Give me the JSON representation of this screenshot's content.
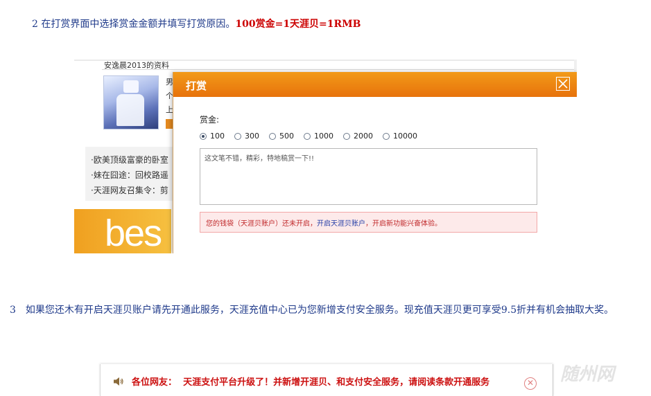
{
  "step2": {
    "text": "2 在打赏界面中选择赏金金额并填写打赏原因。",
    "highlight": "100赏金=1天涯贝=1RMB"
  },
  "screenshot": {
    "profile_title": "安逸晨2013的资料",
    "peek_lines": [
      "男",
      "个",
      "上"
    ],
    "list_items": [
      "·欧美顶级富豪的卧室",
      "·妹在囧途：回校路遥",
      "·天涯网友召集令：剪"
    ],
    "banner_text": "bes"
  },
  "dialog": {
    "title": "打赏",
    "reward_label": "赏金:",
    "amounts": [
      "100",
      "300",
      "500",
      "1000",
      "2000",
      "10000"
    ],
    "selected_amount": "100",
    "reason_placeholder": "这文笔不错，精彩，特地稿赏一下!!",
    "notice_prefix": "您的钱袋（天涯贝账户）还未开启，",
    "notice_link": "开启天涯贝账户",
    "notice_suffix": "，开启新功能兴奋体验。",
    "accent_color": "#e8760e"
  },
  "step3": {
    "text": "3　如果您还木有开启天涯贝账户请先开通此服务，天涯充值中心已为您新增支付安全服务。现充值天涯贝更可享受9.5折并有机会抽取大奖。"
  },
  "announcement": {
    "label": "各位网友：",
    "message": "天涯支付平台升级了！并新增开涯贝、和支付安全服务，请阅读条款开通服务",
    "close_glyph": "✕"
  },
  "watermark": "随州网"
}
